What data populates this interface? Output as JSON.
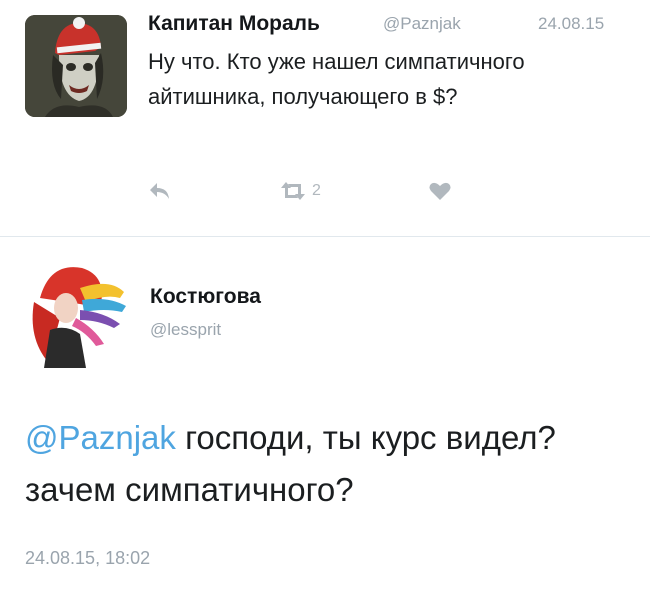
{
  "tweet1": {
    "author_name": "Капитан Мораль",
    "handle": "@Paznjak",
    "date": "24.08.15",
    "text": "Ну что. Кто уже нашел симпатичного айтишника, получающего в $?",
    "actions": {
      "reply_icon": "reply-icon",
      "retweet_icon": "retweet-icon",
      "retweet_count": "2",
      "like_icon": "heart-icon"
    }
  },
  "tweet2": {
    "author_name": "Костюгова",
    "handle": "@lessprit",
    "mention": "@Paznjak",
    "text": " господи, ты курс видел? зачем симпатичного?",
    "timestamp": "24.08.15, 18:02"
  },
  "colors": {
    "mention": "#4fa5e0",
    "muted": "#9aa4ad",
    "icon": "#b1b8be",
    "divider": "#e1e8ed"
  }
}
